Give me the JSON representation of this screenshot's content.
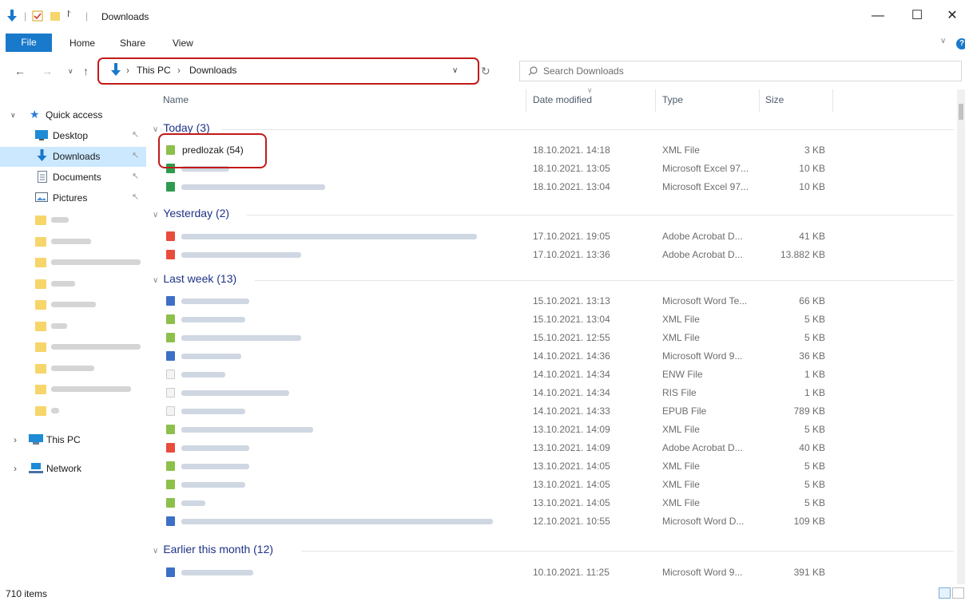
{
  "window": {
    "title": "Downloads",
    "minimize": "—",
    "maximize": "☐",
    "close": "✕"
  },
  "ribbon": {
    "tabs": [
      "File",
      "Home",
      "Share",
      "View"
    ]
  },
  "address": {
    "parts": [
      "This PC",
      "Downloads"
    ]
  },
  "search": {
    "placeholder": "Search Downloads"
  },
  "sidebar": {
    "quick_access": "Quick access",
    "items": [
      {
        "label": "Desktop",
        "icon": "desktop-icon"
      },
      {
        "label": "Downloads",
        "icon": "download-arrow-icon"
      },
      {
        "label": "Documents",
        "icon": "documents-icon"
      },
      {
        "label": "Pictures",
        "icon": "pictures-icon"
      }
    ],
    "this_pc": "This PC",
    "network": "Network"
  },
  "columns": {
    "name": "Name",
    "date": "Date modified",
    "type": "Type",
    "size": "Size"
  },
  "groups": [
    {
      "label": "Today (3)",
      "rows": [
        {
          "name": "predlozak (54)",
          "date": "18.10.2021. 14:18",
          "type": "XML File",
          "size": "3 KB",
          "icon": "xml"
        },
        {
          "name": "",
          "date": "18.10.2021. 13:05",
          "type": "Microsoft Excel 97...",
          "size": "10 KB",
          "icon": "excel"
        },
        {
          "name": "",
          "date": "18.10.2021. 13:04",
          "type": "Microsoft Excel 97...",
          "size": "10 KB",
          "icon": "excel"
        }
      ]
    },
    {
      "label": "Yesterday (2)",
      "rows": [
        {
          "name": "",
          "date": "17.10.2021. 19:05",
          "type": "Adobe Acrobat D...",
          "size": "41 KB",
          "icon": "pdf"
        },
        {
          "name": "",
          "date": "17.10.2021. 13:36",
          "type": "Adobe Acrobat D...",
          "size": "13.882 KB",
          "icon": "pdf"
        }
      ]
    },
    {
      "label": "Last week (13)",
      "rows": [
        {
          "name": "",
          "date": "15.10.2021. 13:13",
          "type": "Microsoft Word Te...",
          "size": "66 KB",
          "icon": "word"
        },
        {
          "name": "",
          "date": "15.10.2021. 13:04",
          "type": "XML File",
          "size": "5 KB",
          "icon": "xml"
        },
        {
          "name": "",
          "date": "15.10.2021. 12:55",
          "type": "XML File",
          "size": "5 KB",
          "icon": "xml"
        },
        {
          "name": "",
          "date": "14.10.2021. 14:36",
          "type": "Microsoft Word 9...",
          "size": "36 KB",
          "icon": "word"
        },
        {
          "name": "",
          "date": "14.10.2021. 14:34",
          "type": "ENW File",
          "size": "1 KB",
          "icon": "blank"
        },
        {
          "name": "",
          "date": "14.10.2021. 14:34",
          "type": "RIS File",
          "size": "1 KB",
          "icon": "blank"
        },
        {
          "name": "",
          "date": "14.10.2021. 14:33",
          "type": "EPUB File",
          "size": "789 KB",
          "icon": "blank"
        },
        {
          "name": "",
          "date": "13.10.2021. 14:09",
          "type": "XML File",
          "size": "5 KB",
          "icon": "xml"
        },
        {
          "name": "",
          "date": "13.10.2021. 14:09",
          "type": "Adobe Acrobat D...",
          "size": "40 KB",
          "icon": "pdf"
        },
        {
          "name": "",
          "date": "13.10.2021. 14:05",
          "type": "XML File",
          "size": "5 KB",
          "icon": "xml"
        },
        {
          "name": "",
          "date": "13.10.2021. 14:05",
          "type": "XML File",
          "size": "5 KB",
          "icon": "xml"
        },
        {
          "name": "",
          "date": "13.10.2021. 14:05",
          "type": "XML File",
          "size": "5 KB",
          "icon": "xml"
        },
        {
          "name": "",
          "date": "12.10.2021. 10:55",
          "type": "Microsoft Word D...",
          "size": "109 KB",
          "icon": "word"
        }
      ]
    },
    {
      "label": "Earlier this month (12)",
      "rows": [
        {
          "name": "",
          "date": "10.10.2021. 11:25",
          "type": "Microsoft Word 9...",
          "size": "391 KB",
          "icon": "word"
        }
      ]
    }
  ],
  "status": {
    "items": "710 items"
  },
  "colors": {
    "accent": "#1979ca",
    "highlight": "#c21a1a",
    "selected": "#cce8ff",
    "group_text": "#1e3287"
  }
}
